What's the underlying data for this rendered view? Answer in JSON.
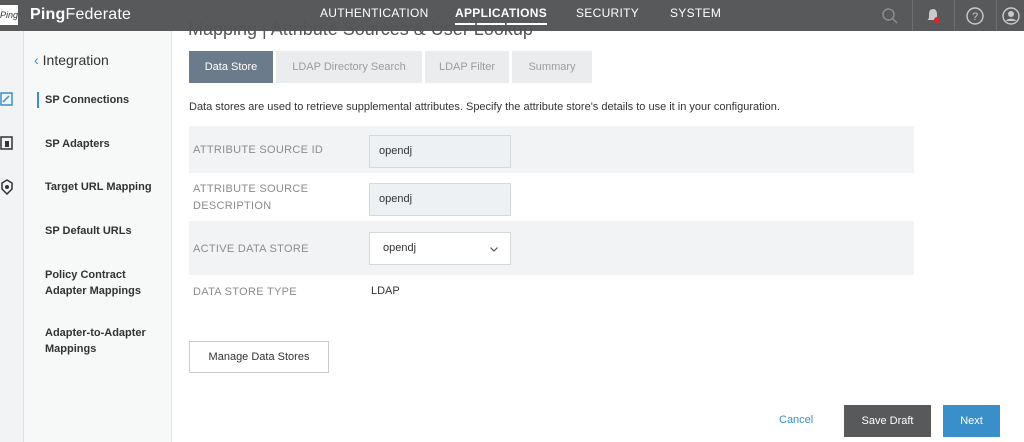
{
  "header": {
    "logo_text": "Ping",
    "brand_bold": "Ping",
    "brand_light": "Federate",
    "nav": [
      {
        "label": "AUTHENTICATION",
        "active": false
      },
      {
        "label": "APPLICATIONS",
        "active": true
      },
      {
        "label": "SECURITY",
        "active": false
      },
      {
        "label": "SYSTEM",
        "active": false
      }
    ],
    "icons": [
      "search-icon",
      "notification-bell-icon",
      "help-icon",
      "user-avatar-icon"
    ],
    "notification_color": "#d9262b"
  },
  "sidebar": {
    "back_label": "Integration",
    "items": [
      {
        "label": "SP Connections",
        "active": true
      },
      {
        "label": "SP Adapters",
        "active": false
      },
      {
        "label": "Target URL Mapping",
        "active": false
      },
      {
        "label": "SP Default URLs",
        "active": false
      },
      {
        "label": "Policy Contract Adapter Mappings",
        "active": false
      },
      {
        "label": "Adapter-to-Adapter Mappings",
        "active": false
      }
    ],
    "accent": "#3a8ec9"
  },
  "main": {
    "breadcrumb": "Mapping | Attribute Sources & User Lookup",
    "tabs": [
      {
        "label": "Data Store",
        "active": true
      },
      {
        "label": "LDAP Directory Search",
        "active": false
      },
      {
        "label": "LDAP Filter",
        "active": false
      },
      {
        "label": "Summary",
        "active": false
      }
    ],
    "description": "Data stores are used to retrieve supplemental attributes. Specify the attribute store's details to use it in your configuration.",
    "form": {
      "source_id_label": "ATTRIBUTE SOURCE ID",
      "source_id_value": "opendj",
      "source_desc_label_1": "ATTRIBUTE SOURCE",
      "source_desc_label_2": "DESCRIPTION",
      "source_desc_value": "opendj",
      "active_store_label": "ACTIVE DATA STORE",
      "active_store_value": "opendj",
      "store_type_label": "DATA STORE TYPE",
      "store_type_value": "LDAP"
    },
    "manage_button": "Manage Data Stores",
    "footer": {
      "cancel": "Cancel",
      "save_draft": "Save Draft",
      "next": "Next"
    }
  }
}
